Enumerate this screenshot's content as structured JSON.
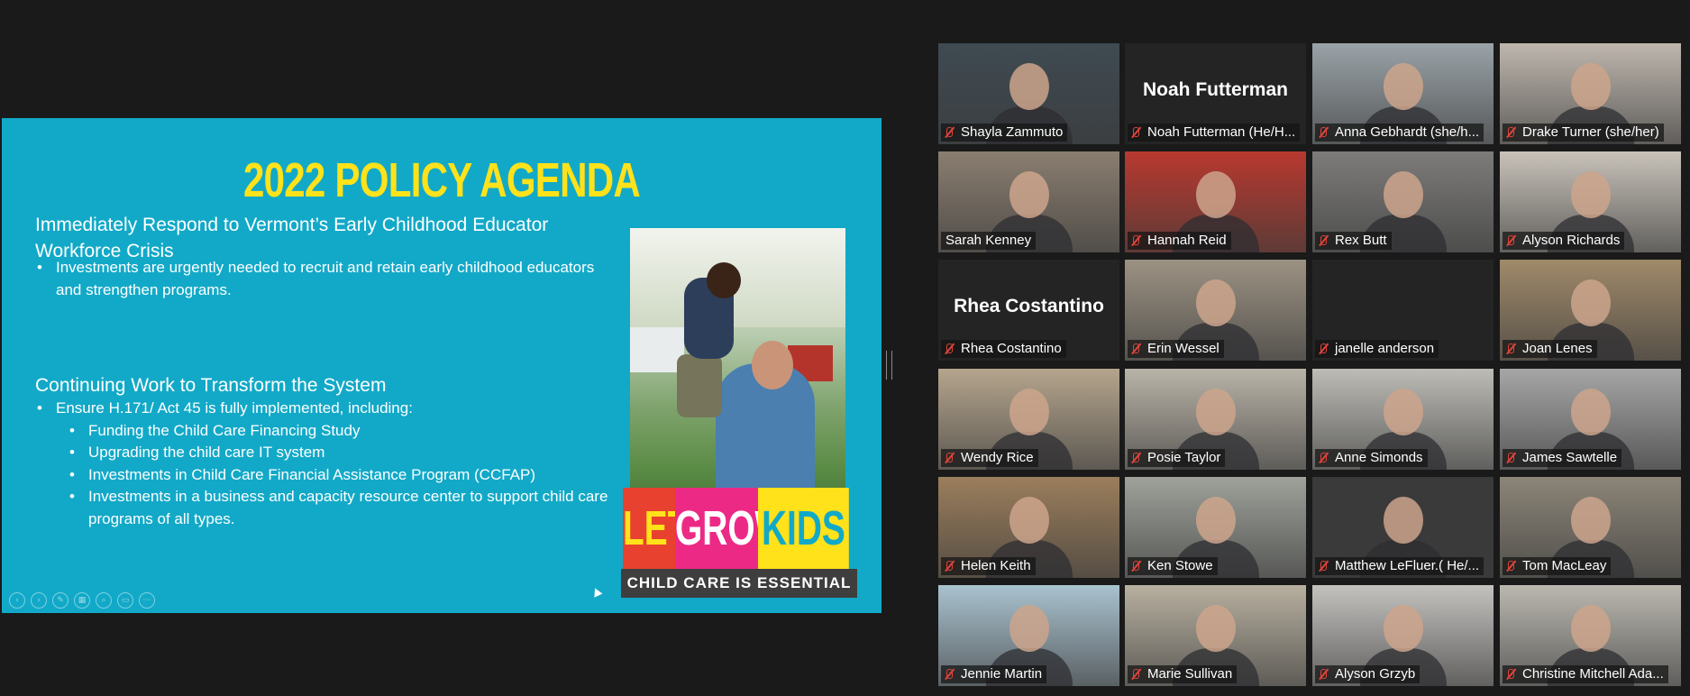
{
  "slide": {
    "title": "2022 POLICY AGENDA",
    "section1_heading": "Immediately Respond to Vermont’s Early Childhood Educator Workforce Crisis",
    "section1_bullets": [
      "Investments are urgently needed to recruit and retain early childhood educators and strengthen programs."
    ],
    "section2_heading": "Continuing Work to Transform the System",
    "section2_bullets": [
      "Ensure H.171/ Act 45 is fully implemented, including:"
    ],
    "section2_subbullets": [
      "Funding the Child Care Financing Study",
      "Upgrading the child care IT system",
      "Investments in Child Care Financial Assistance Program (CCFAP)",
      "Investments in a business and capacity resource center to support child care programs of all types."
    ],
    "logo": {
      "word1": "LET'S",
      "word2": "GROW",
      "word3": "KIDS",
      "tagline": "CHILD CARE IS ESSENTIAL"
    },
    "colors": {
      "background": "#12a9c8",
      "title": "#ffe21a"
    }
  },
  "participants": [
    {
      "name": "Shayla Zammuto",
      "video": "#3f4a52",
      "muted": true
    },
    {
      "name": "Noah Futterman (He/H...",
      "avatar": "Noah Futterman",
      "muted": true
    },
    {
      "name": "Anna Gebhardt (she/h...",
      "video": "#9aa3a8",
      "muted": true
    },
    {
      "name": "Drake Turner (she/her)",
      "video": "#bfb7ae",
      "muted": true
    },
    {
      "name": "Sarah Kenney",
      "video": "#8a7e70",
      "muted": false,
      "active": true
    },
    {
      "name": "Hannah Reid",
      "video": "#b8392f",
      "muted": true
    },
    {
      "name": "Rex Butt",
      "video": "#7d7c7a",
      "muted": true
    },
    {
      "name": "Alyson Richards",
      "video": "#c8c2b9",
      "muted": true
    },
    {
      "name": "Rhea Costantino",
      "avatar": "Rhea Costantino",
      "muted": true
    },
    {
      "name": "Erin Wessel",
      "video": "#9c9283",
      "muted": true
    },
    {
      "name": "janelle anderson",
      "muted": true
    },
    {
      "name": "Joan Lenes",
      "video": "#a08a6a",
      "muted": true
    },
    {
      "name": "Wendy Rice",
      "video": "#b5a58d",
      "muted": true
    },
    {
      "name": "Posie Taylor",
      "video": "#b9b3a7",
      "muted": true
    },
    {
      "name": "Anne Simonds",
      "video": "#bdbcb6",
      "muted": true
    },
    {
      "name": "James Sawtelle",
      "video": "#a6a6a6",
      "muted": true
    },
    {
      "name": "Helen Keith",
      "video": "#9b7e5c",
      "muted": true
    },
    {
      "name": "Ken Stowe",
      "video": "#9ea29a",
      "muted": true
    },
    {
      "name": "Matthew LeFluer.( He/...",
      "video": "#3a3a3a",
      "muted": true
    },
    {
      "name": "Tom MacLeay",
      "video": "#8c8578",
      "muted": true
    },
    {
      "name": "Jennie Martin",
      "video": "#a9c2cf",
      "muted": true
    },
    {
      "name": "Marie Sullivan",
      "video": "#b8b0a0",
      "muted": true
    },
    {
      "name": "Alyson Grzyb",
      "video": "#c4c2bf",
      "muted": true
    },
    {
      "name": "Christine Mitchell Ada...",
      "video": "#bbb8b0",
      "muted": true
    }
  ]
}
